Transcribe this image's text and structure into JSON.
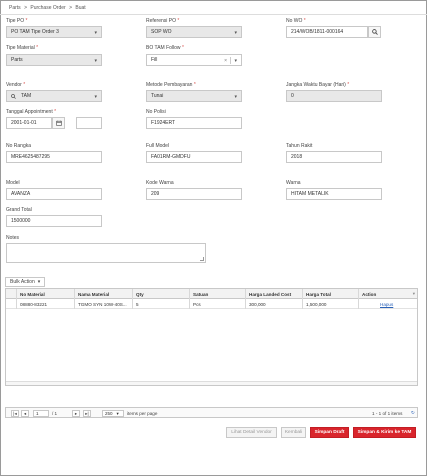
{
  "breadcrumb": {
    "items": [
      "Parts",
      ">",
      "Purchase Order",
      ">",
      "Buat"
    ]
  },
  "form": {
    "tipe_po": {
      "label": "Tipe PO",
      "required": "*",
      "value": "PO TAM Tipe Order 3"
    },
    "referensi_po": {
      "label": "Referensi PO",
      "required": "*",
      "value": "SOP WO"
    },
    "no_wo": {
      "label": "No WO",
      "required": "*",
      "value": "214/WOB/1811-000164"
    },
    "tipe_material": {
      "label": "Tipe Material",
      "required": "*",
      "value": "Parts"
    },
    "bo_tam_follow": {
      "label": "BO TAM Follow",
      "required": "*",
      "value": "Fill"
    },
    "vendor": {
      "label": "Vendor",
      "required": "*",
      "value": "TAM"
    },
    "metode_pembayaran": {
      "label": "Metode Pembayaran",
      "required": "*",
      "value": "Tunai"
    },
    "jangka_waktu": {
      "label": "Jangka Waktu Bayar (Hari)",
      "required": "*",
      "value": "0"
    },
    "tanggal_appointment": {
      "label": "Tanggal Appointment",
      "required": "*",
      "value": "2001-01-01",
      "time_value": ""
    },
    "no_polisi": {
      "label": "No Polisi",
      "value": "F1924ERT"
    },
    "no_rangka": {
      "label": "No Rangka",
      "value": "MRE4625487295"
    },
    "full_model": {
      "label": "Full Model",
      "value": "FA01RM-GMDFU"
    },
    "tahun_rakit": {
      "label": "Tahun Rakit",
      "value": "2018"
    },
    "model": {
      "label": "Model",
      "value": "AVANZA"
    },
    "kode_warna": {
      "label": "Kode Warna",
      "value": "209"
    },
    "warna": {
      "label": "Warna",
      "value": "HITAM METALIK"
    },
    "grand_total": {
      "label": "Grand Total",
      "value": "1500000"
    },
    "notes": {
      "label": "Notes",
      "value": ""
    }
  },
  "grid": {
    "bulk_action": "Bulk Action",
    "columns": [
      "No Material",
      "Nama Material",
      "Qty",
      "Satuan",
      "Harga Landed Cost",
      "Harga Total",
      "Action"
    ],
    "rows": [
      {
        "no_material": "08880-83221",
        "nama_material": "TGMO SYN 10W-40S...",
        "qty": "5",
        "satuan": "Pcs",
        "harga_landed_cost": "300,000",
        "harga_total": "1,500,000",
        "action": "Hapus"
      }
    ]
  },
  "pager": {
    "page": "1",
    "of_pages": "/ 1",
    "page_size": "250",
    "per_page_label": "items per page",
    "summary": "1 - 1 of 1 items"
  },
  "actions": {
    "lihat_detail_vendor": "Lihat Detail Vendor",
    "kembali": "Kembali",
    "simpan_draft": "Simpan Draft",
    "simpan_kirim": "Simpan & Kirim ke TAM"
  },
  "colors": {
    "primary_red": "#d9252c",
    "link_blue": "#2a62b8",
    "readonly_grey": "#e8e8e8"
  }
}
